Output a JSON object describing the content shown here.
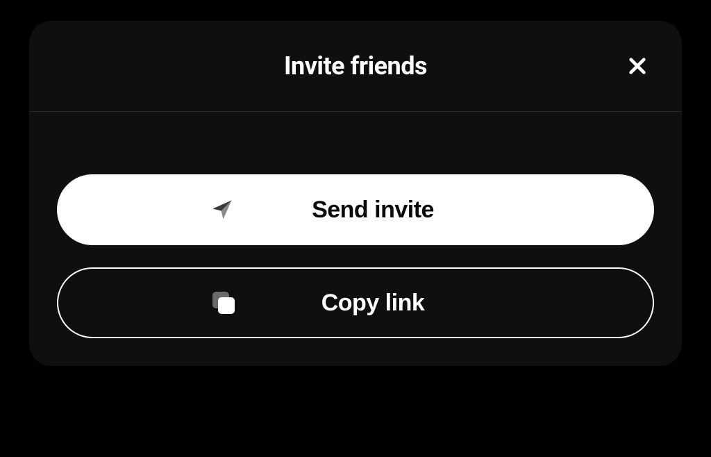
{
  "dialog": {
    "title": "Invite friends",
    "buttons": {
      "send": "Send invite",
      "copy": "Copy link"
    }
  }
}
